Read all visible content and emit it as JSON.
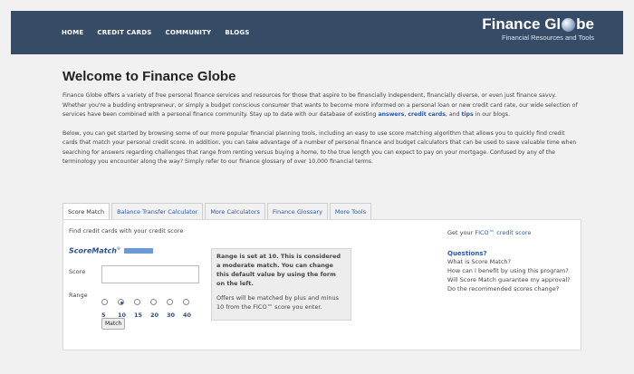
{
  "header": {
    "nav": [
      "HOME",
      "CREDIT CARDS",
      "COMMUNITY",
      "BLOGS"
    ],
    "logo_title_left": "Finance Gl",
    "logo_title_right": "be",
    "logo_subtitle": "Financial Resources and Tools"
  },
  "main": {
    "title": "Welcome to Finance Globe",
    "para1_text": "Finance Globe offers a variety of free personal finance services and resources for those that aspire to be financially independent, financially diverse, or even just finance savvy. Whether you're a budding entrepreneur, or simply a budget conscious consumer that wants to become more informed on a personal loan or new credit card rate, our wide selection of services have been combined with a personal finance community. Stay up to date with our database of existing ",
    "link_answers": "answers",
    "sep1": ", ",
    "link_credit_cards": "credit cards",
    "sep2": ", and ",
    "link_tips": "tips",
    "para1_end": " in our blogs.",
    "para2": "Below, you can get started by browsing some of our more popular financial planning tools, including an easy to use score matching algorithm that allows you to quickly find credit cards that match your personal credit score. In addition, you can take advantage of a number of personal finance and budget calculators that can be used to save valuable time when searching for answers regarding challenges that range from renting versus buying a home, to the true length you can expect to pay on your mortgage. Confused by any of the terminology you encounter along the way? Simply refer to our finance glossary of over 10,000 financial terms."
  },
  "tabs": [
    "Score Match",
    "Balance Transfer Calculator",
    "More Calculators",
    "Finance Glossary",
    "More Tools"
  ],
  "panel": {
    "intro": "Find credit cards with your credit score",
    "scorematch_logo": "ScoreMatch",
    "score_label": "Score",
    "score_value": "",
    "range_label": "Range",
    "range_options": [
      "5",
      "10",
      "15",
      "20",
      "30",
      "40"
    ],
    "range_selected": "10",
    "match_button": "Match",
    "info_strong": "Range is set at 10. This is considered a moderate match. You can change this default value by using the form on the left.",
    "info_norm": "Offers will be matched by plus and minus 10 from the FICO™ score you enter.",
    "fico_prefix": "Get your ",
    "fico_link": "FICO™ credit score",
    "questions_title": "Questions?",
    "questions": [
      "What is Score Match?",
      "How can I benefit by using this program?",
      "Will Score Match guarantee my approval?",
      "Do the recommended scores change?"
    ]
  }
}
